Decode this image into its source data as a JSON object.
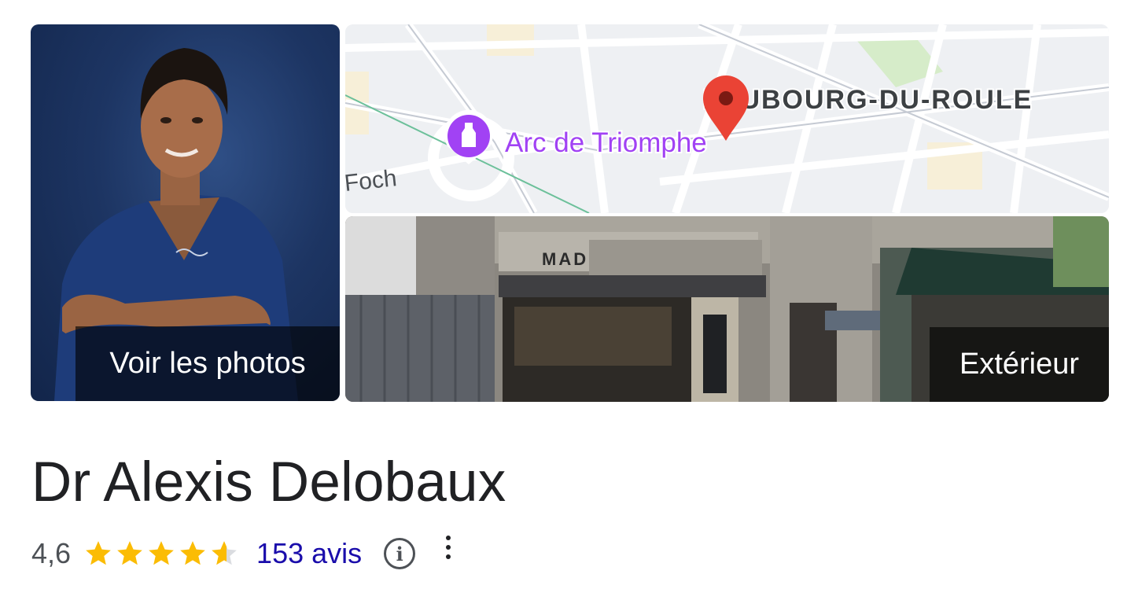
{
  "gallery": {
    "photos_label": "Voir les photos",
    "exterior_label": "Extérieur"
  },
  "map": {
    "district_label": "FAUBOURG-DU-ROULE",
    "landmark_label": "Arc de Triomphe",
    "street_label": "Foch",
    "landmark_icon": "monument-icon",
    "pin_icon": "location-pin-icon",
    "landmark_color": "#a142f4",
    "pin_color": "#ea4335"
  },
  "storefront": {
    "shop_sign": "MADE"
  },
  "business": {
    "name": "Dr Alexis Delobaux"
  },
  "rating": {
    "value": "4,6",
    "stars": 4.6,
    "max_stars": 5,
    "star_color": "#fbbc04",
    "reviews_label": "153 avis"
  },
  "icons": {
    "info": "info-icon",
    "more": "more-vert-icon"
  }
}
